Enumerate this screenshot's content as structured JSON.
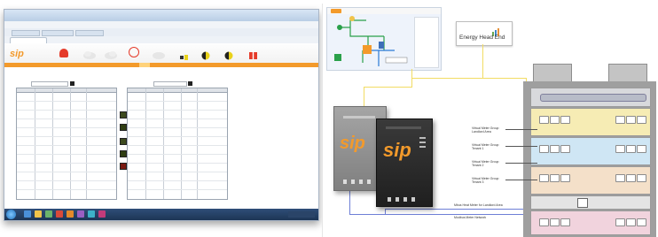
{
  "diagram": {
    "head_end_label": "Energy Head End",
    "sip_label": "sip",
    "floor_labels": [
      "Virtual Meter Group Landlord Area",
      "Virtual Meter Group Tenant 1",
      "Virtual Meter Group Tenant 2",
      "Virtual Meter Group Tenant 3"
    ],
    "network_labels": [
      "Mbus Heat Meter for Landlord Area",
      "Modbus Meter Network"
    ]
  },
  "colors": {
    "accent_orange": "#f39a2b",
    "cable_yellow": "#f2dc63",
    "cable_blue": "#6e7fd6",
    "floor_grey": "#b7b9bd",
    "floor_yellow": "#f6ecb4",
    "floor_blue": "#cfe6f4",
    "floor_peach": "#f4e0c9",
    "floor_pink": "#f1d3dd",
    "panel_dark": "#2f2f2f",
    "panel_grey": "#8a8a8a"
  }
}
